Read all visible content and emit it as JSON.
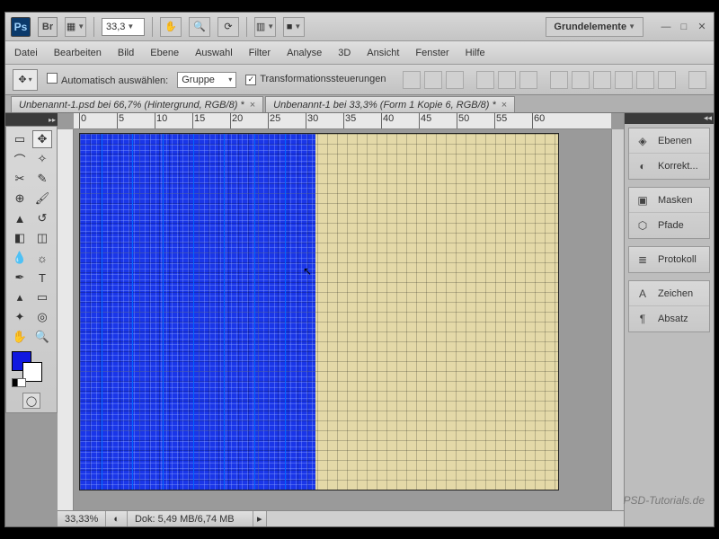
{
  "topbar": {
    "ps": "Ps",
    "br": "Br",
    "zoom": "33,3",
    "workspace": "Grundelemente"
  },
  "menu": [
    "Datei",
    "Bearbeiten",
    "Bild",
    "Ebene",
    "Auswahl",
    "Filter",
    "Analyse",
    "3D",
    "Ansicht",
    "Fenster",
    "Hilfe"
  ],
  "options": {
    "auto_select": "Automatisch auswählen:",
    "group": "Gruppe",
    "transform": "Transformationssteuerungen"
  },
  "tabs": [
    "Unbenannt-1.psd bei 66,7% (Hintergrund, RGB/8) *",
    "Unbenannt-1 bei 33,3% (Form 1 Kopie 6, RGB/8) *"
  ],
  "ruler_ticks": [
    "0",
    "5",
    "10",
    "15",
    "20",
    "25",
    "30",
    "35",
    "40",
    "45",
    "50",
    "55",
    "60"
  ],
  "panels": {
    "group1": [
      {
        "icon": "◈",
        "label": "Ebenen"
      },
      {
        "icon": "◐",
        "label": "Korrekt..."
      }
    ],
    "group2": [
      {
        "icon": "▣",
        "label": "Masken"
      },
      {
        "icon": "⬡",
        "label": "Pfade"
      }
    ],
    "group3": [
      {
        "icon": "≣",
        "label": "Protokoll"
      }
    ],
    "group4": [
      {
        "icon": "A",
        "label": "Zeichen"
      },
      {
        "icon": "¶",
        "label": "Absatz"
      }
    ]
  },
  "status": {
    "zoom": "33,33%",
    "docsize": "Dok: 5,49 MB/6,74 MB"
  },
  "watermark": "PSD-Tutorials.de",
  "colors": {
    "foreground": "#1018e0",
    "background": "#ffffff"
  }
}
